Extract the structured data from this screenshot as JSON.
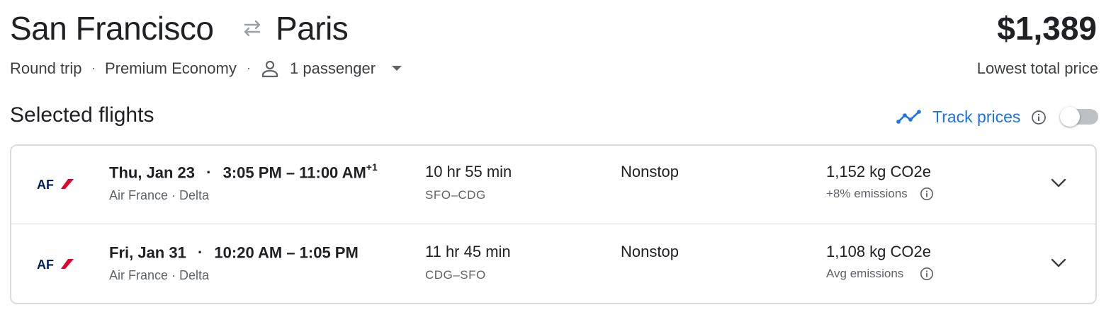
{
  "header": {
    "origin": "San Francisco",
    "destination": "Paris",
    "price": "$1,389",
    "price_label": "Lowest total price"
  },
  "options": {
    "trip_type": "Round trip",
    "cabin": "Premium Economy",
    "passengers": "1 passenger",
    "separator": "·"
  },
  "section": {
    "title": "Selected flights",
    "track_prices": "Track prices",
    "track_enabled": false
  },
  "flights": [
    {
      "date": "Thu, Jan 23",
      "sep": "·",
      "times": "3:05 PM – 11:00 AM",
      "day_offset": "+1",
      "carriers": "Air France · Delta",
      "duration": "10 hr 55 min",
      "route": "SFO–CDG",
      "stops": "Nonstop",
      "emissions": "1,152 kg CO2e",
      "emissions_note": "+8% emissions"
    },
    {
      "date": "Fri, Jan 31",
      "sep": "·",
      "times": "10:20 AM – 1:05 PM",
      "day_offset": "",
      "carriers": "Air France · Delta",
      "duration": "11 hr 45 min",
      "route": "CDG–SFO",
      "stops": "Nonstop",
      "emissions": "1,108 kg CO2e",
      "emissions_note": "Avg emissions"
    }
  ],
  "airline_logo_text": "AF",
  "colors": {
    "accent": "#1a73e8",
    "text": "#202124",
    "muted": "#5f6368",
    "border": "#dadce0",
    "af_blue": "#002157",
    "af_red": "#e4002b"
  },
  "icons": [
    "swap-arrows-icon",
    "person-icon",
    "caret-down-icon",
    "trend-line-icon",
    "info-icon",
    "chevron-down-icon"
  ]
}
